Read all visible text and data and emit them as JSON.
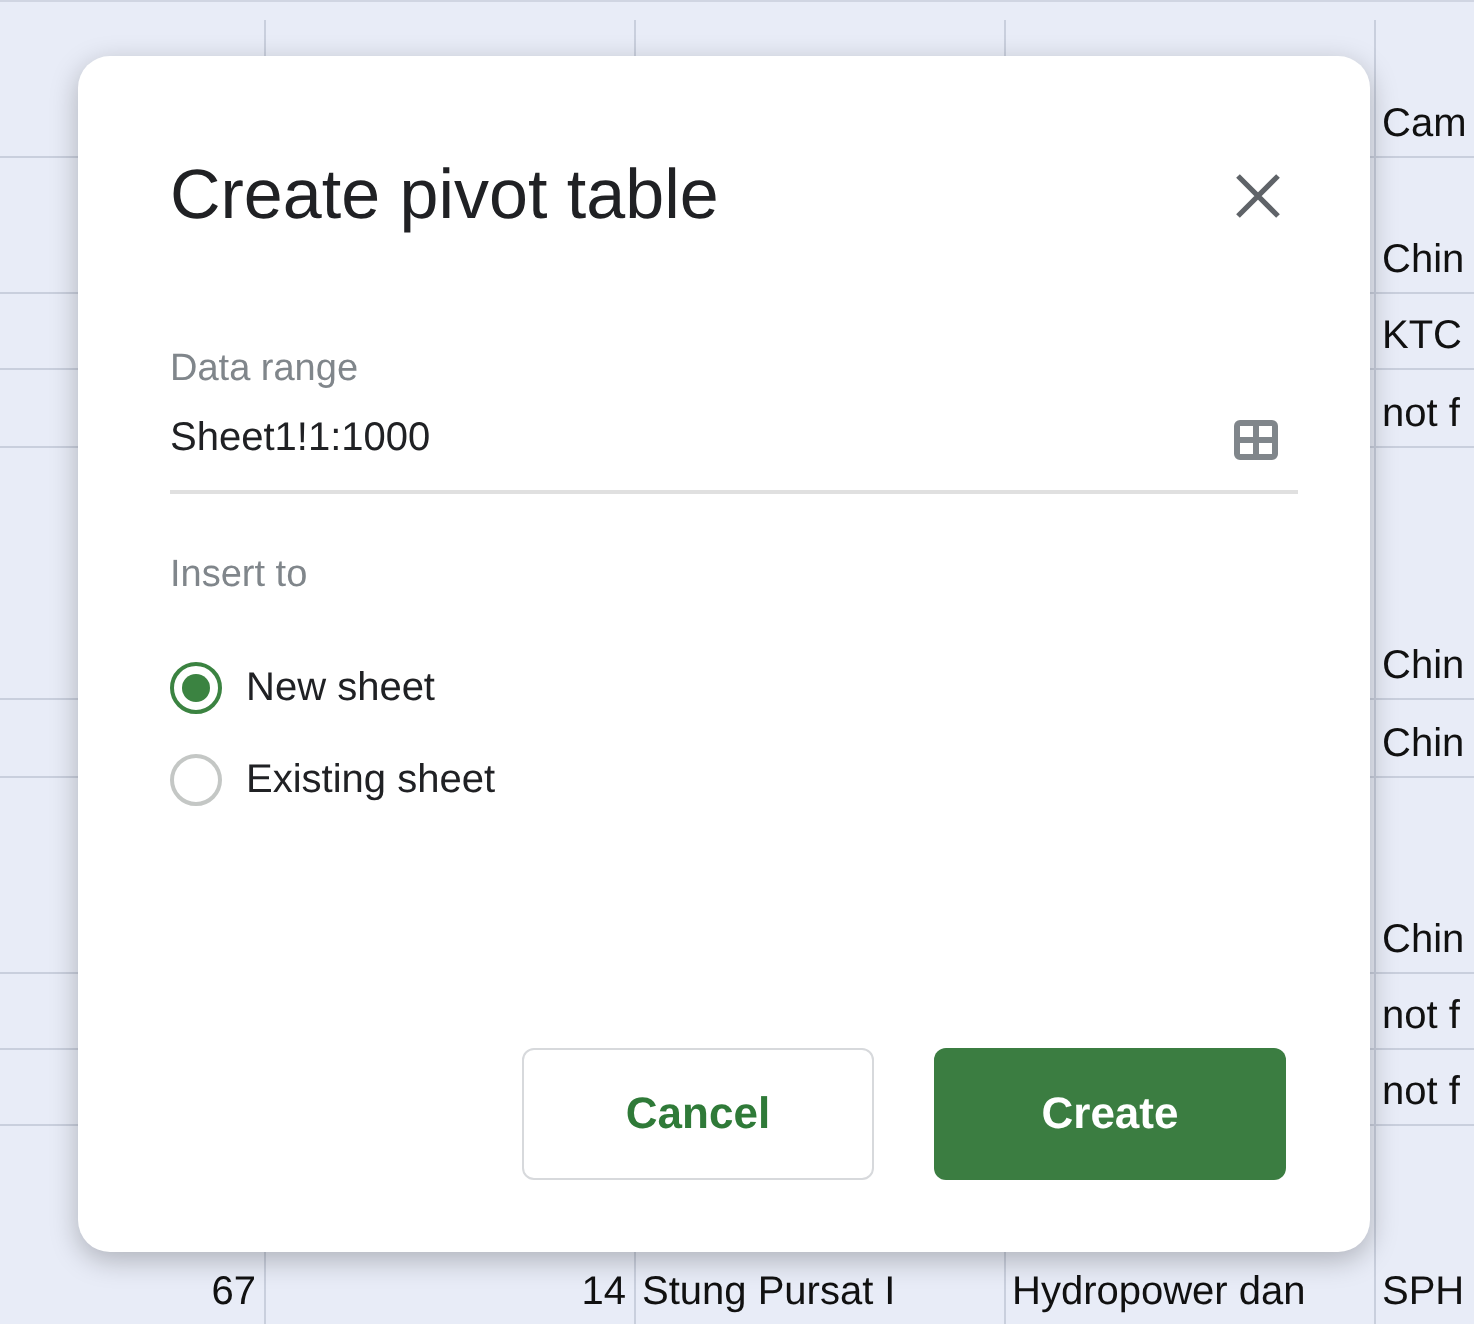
{
  "sheet": {
    "rows": [
      {
        "column_5": "Cam"
      },
      {
        "column_5": "Chin"
      },
      {
        "column_5": "KTC"
      },
      {
        "column_5": "not f"
      },
      {
        "column_5": "Chin"
      },
      {
        "column_5": "Chin"
      },
      {
        "column_5": "Chin"
      },
      {
        "column_5": "not f"
      },
      {
        "column_5": "not f"
      },
      {
        "column_1": "67",
        "column_2": "14",
        "column_3": "Stung Pursat I",
        "column_4": "Hydropower dan",
        "column_5": "SPH"
      }
    ]
  },
  "dialog": {
    "title": "Create pivot table",
    "data_range": {
      "label": "Data range",
      "value": "Sheet1!1:1000"
    },
    "insert_to": {
      "label": "Insert to",
      "options": [
        {
          "label": "New sheet",
          "selected": true
        },
        {
          "label": "Existing sheet",
          "selected": false
        }
      ]
    },
    "buttons": [
      {
        "label": "Cancel",
        "kind": "secondary"
      },
      {
        "label": "Create",
        "kind": "primary"
      }
    ]
  }
}
